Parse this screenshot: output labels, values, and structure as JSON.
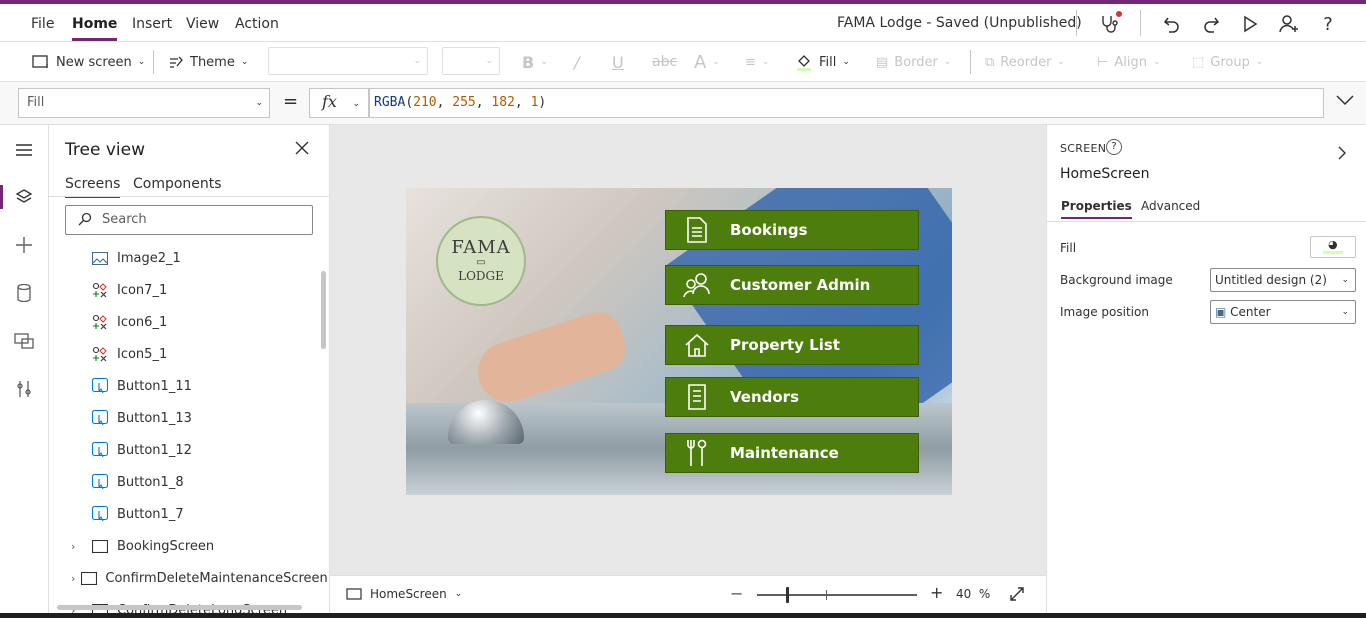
{
  "menu": {
    "items": [
      "File",
      "Home",
      "Insert",
      "View",
      "Action"
    ],
    "active": "Home",
    "app_title": "FAMA Lodge - Saved (Unpublished)"
  },
  "toolbar_icons": [
    "stethoscope-icon",
    "undo-icon",
    "redo-icon",
    "play-icon",
    "share-user-icon",
    "help-icon"
  ],
  "ribbon": {
    "new_screen": "New screen",
    "theme": "Theme",
    "fill": "Fill",
    "border": "Border",
    "reorder": "Reorder",
    "align": "Align",
    "group": "Group"
  },
  "formula_bar": {
    "property": "Fill",
    "equals": "=",
    "fx": "fx",
    "fn": "RGBA",
    "args": [
      "210",
      "255",
      "182",
      "1"
    ]
  },
  "tree_view": {
    "title": "Tree view",
    "tabs": [
      "Screens",
      "Components"
    ],
    "search_placeholder": "Search",
    "items": [
      {
        "label": "Image2_1",
        "icon": "image-icon",
        "indent": 2
      },
      {
        "label": "Icon7_1",
        "icon": "icon-control-icon",
        "indent": 2
      },
      {
        "label": "Icon6_1",
        "icon": "icon-control-icon",
        "indent": 2
      },
      {
        "label": "Icon5_1",
        "icon": "icon-control-icon",
        "indent": 2
      },
      {
        "label": "Button1_11",
        "icon": "button-icon",
        "indent": 2
      },
      {
        "label": "Button1_13",
        "icon": "button-icon",
        "indent": 2
      },
      {
        "label": "Button1_12",
        "icon": "button-icon",
        "indent": 2
      },
      {
        "label": "Button1_8",
        "icon": "button-icon",
        "indent": 2
      },
      {
        "label": "Button1_7",
        "icon": "button-icon",
        "indent": 2
      },
      {
        "label": "BookingScreen",
        "icon": "screen-icon",
        "indent": 1
      },
      {
        "label": "ConfirmDeleteMaintenanceScreen",
        "icon": "screen-icon",
        "indent": 1
      },
      {
        "label": "ConfirmDeleteLongScreen",
        "icon": "screen-icon",
        "indent": 1
      }
    ]
  },
  "app_preview": {
    "logo_name": "FAMA",
    "logo_sub": "LODGE",
    "buttons": [
      {
        "label": "Bookings",
        "icon": "document-icon"
      },
      {
        "label": "Customer Admin",
        "icon": "people-icon"
      },
      {
        "label": "Property List",
        "icon": "home-icon"
      },
      {
        "label": "Vendors",
        "icon": "list-document-icon"
      },
      {
        "label": "Maintenance",
        "icon": "tools-icon"
      }
    ]
  },
  "canvas_footer": {
    "screen": "HomeScreen",
    "zoom_value": "40",
    "zoom_unit": "%"
  },
  "properties": {
    "type": "SCREEN",
    "name": "HomeScreen",
    "tabs": [
      "Properties",
      "Advanced"
    ],
    "fill_label": "Fill",
    "fill_color": "#d2ffb6",
    "bg_image_label": "Background image",
    "bg_image_value": "Untitled design (2)",
    "image_position_label": "Image position",
    "image_position_value": "Center"
  },
  "colors": {
    "accent": "#742774",
    "app_button": "#4d7d0c"
  }
}
